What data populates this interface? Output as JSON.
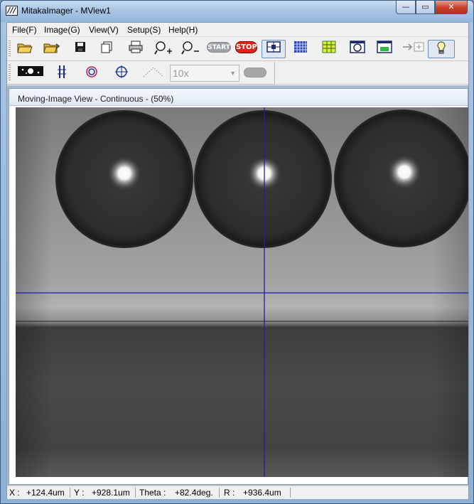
{
  "window": {
    "title": "MitakaImager - MView1",
    "icon_label": "///",
    "controls": {
      "minimize": "—",
      "maximize": "▭",
      "close": "✕"
    }
  },
  "menu": {
    "items": [
      "File(F)",
      "Image(G)",
      "View(V)",
      "Setup(S)",
      "Help(H)"
    ]
  },
  "toolbar1": {
    "buttons": [
      {
        "icon": "open-folder-icon"
      },
      {
        "icon": "open-folder-back-icon"
      },
      {
        "icon": "save-disk-icon"
      },
      {
        "icon": "copy-icon"
      },
      {
        "icon": "print-icon"
      },
      {
        "icon": "zoom-in-icon"
      },
      {
        "icon": "zoom-out-icon"
      },
      {
        "icon": "start-button-icon"
      },
      {
        "icon": "stop-button-icon"
      },
      {
        "icon": "crosshair-view-icon",
        "pressed": true
      },
      {
        "icon": "grid-icon"
      },
      {
        "icon": "grid-yellow-icon"
      },
      {
        "icon": "circle-frame-icon"
      },
      {
        "icon": "green-frame-icon"
      },
      {
        "icon": "arrow-to-box-icon"
      },
      {
        "icon": "lightbulb-icon",
        "pressed": true
      }
    ],
    "start_label": "START",
    "stop_label": "STOP"
  },
  "toolbar2": {
    "buttons": [
      {
        "icon": "image-mode-icon"
      },
      {
        "icon": "parallel-lines-icon"
      },
      {
        "icon": "target-rings-icon"
      },
      {
        "icon": "crosshair-circle-icon"
      },
      {
        "icon": "dotted-angle-icon"
      }
    ],
    "zoom_select": {
      "value": "10x",
      "disabled": true
    }
  },
  "view": {
    "title": "Moving-Image View - Continuous - (50%)",
    "crosshair_color": "#1e1eb0"
  },
  "status": {
    "x_label": "X :",
    "x_value": "+124.4um",
    "y_label": "Y :",
    "y_value": "+928.1um",
    "theta_label": "Theta :",
    "theta_value": "+82.4deg.",
    "r_label": "R :",
    "r_value": "+936.4um"
  }
}
